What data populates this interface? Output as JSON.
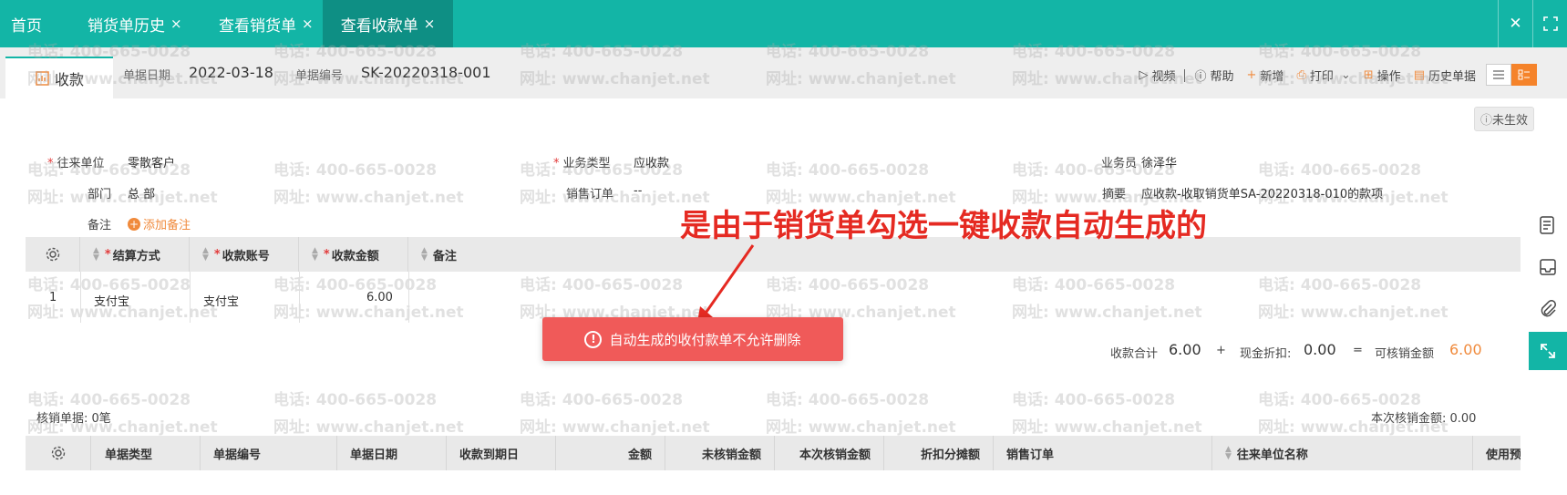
{
  "tabs": [
    {
      "label": "首页",
      "closable": false
    },
    {
      "label": "销货单历史",
      "closable": true
    },
    {
      "label": "查看销货单",
      "closable": true
    },
    {
      "label": "查看收款单",
      "closable": true,
      "active": true
    }
  ],
  "tab_close_glyph": "×",
  "doc": {
    "tab_label": "收款",
    "date_label": "单据日期",
    "date_value": "2022-03-18",
    "no_label": "单据编号",
    "no_value": "SK-20220318-001"
  },
  "toolbar": {
    "video": "视频",
    "help": "帮助",
    "add": "新增",
    "print": "打印",
    "operate": "操作",
    "history": "历史单据"
  },
  "status_badge": "未生效",
  "watermark": {
    "phone": "电话: 400-665-0028",
    "site": "网址: www.chanjet.net"
  },
  "form": {
    "partner_label": "往来单位",
    "partner_value": "零散客户",
    "biz_type_label": "业务类型",
    "biz_type_value": "应收款",
    "salesman_label": "业务员",
    "salesman_value": "徐泽华",
    "dept_label": "部门",
    "dept_value": "总 部",
    "sales_order_label": "销售订单",
    "sales_order_value": "--",
    "summary_label": "摘要",
    "summary_value": "应收款-收取销货单SA-20220318-010的款项",
    "remark_label": "备注",
    "add_remark": "添加备注"
  },
  "annotation": "是由于销货单勾选一键收款自动生成的",
  "payment_table": {
    "columns": [
      "结算方式",
      "收款账号",
      "收款金额",
      "备注"
    ],
    "rows": [
      {
        "index": "1",
        "method": "支付宝",
        "account": "支付宝",
        "amount": "6.00",
        "remark": ""
      }
    ]
  },
  "toast": "自动生成的收付款单不允许删除",
  "totals": {
    "total_label": "收款合计",
    "total_value": "6.00",
    "plus": "+",
    "discount_label": "现金折扣:",
    "discount_value": "0.00",
    "equals": "=",
    "writeoff_label": "可核销金额",
    "writeoff_value": "6.00"
  },
  "writeoff": {
    "count_label": "核销单据: 0笔",
    "amount_label": "本次核销金额: 0.00"
  },
  "writeoff_table": {
    "columns": [
      "单据类型",
      "单据编号",
      "单据日期",
      "收款到期日",
      "金额",
      "未核销金额",
      "本次核销金额",
      "折扣分摊额",
      "销售订单",
      "往来单位名称",
      "使用预"
    ]
  },
  "colors": {
    "brand": "#13b5a6",
    "accent": "#f08a3c",
    "toast": "#f05a59",
    "annotation": "#e52a22"
  }
}
